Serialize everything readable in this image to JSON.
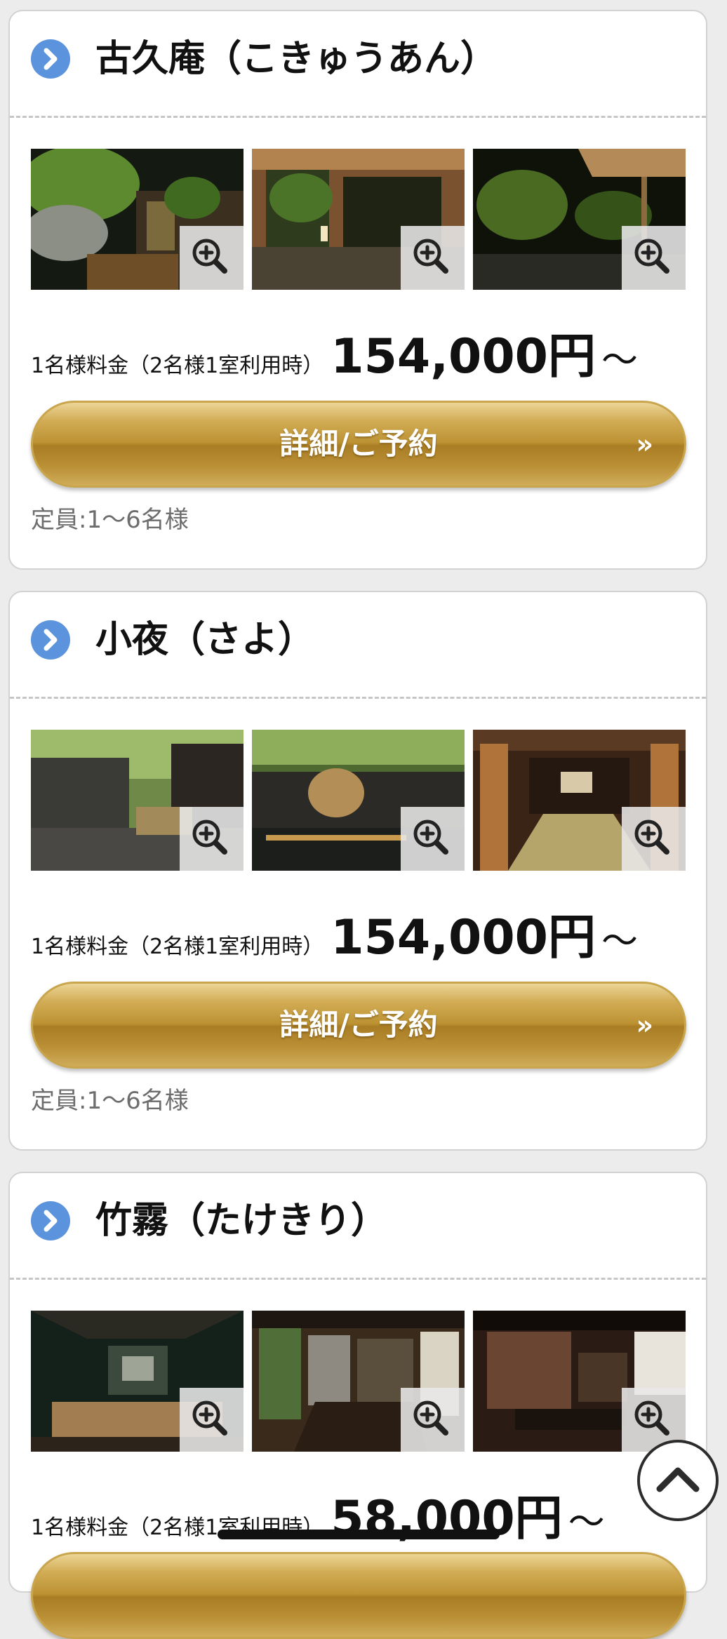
{
  "rooms": [
    {
      "title": "古久庵（こきゅうあん）",
      "price_label": "1名様料金（2名様1室利用時）",
      "price": "154,000円",
      "price_suffix": "〜",
      "button_label": "詳細/ご予約",
      "button_arrow": "»",
      "capacity": "定員:1〜6名様",
      "photos": [
        "garden-night-photo",
        "indoor-bath-photo",
        "terrace-night-photo"
      ]
    },
    {
      "title": "小夜（さよ）",
      "price_label": "1名様料金（2名様1室利用時）",
      "price": "154,000円",
      "price_suffix": "〜",
      "button_label": "詳細/ご予約",
      "button_arrow": "»",
      "capacity": "定員:1〜6名様",
      "photos": [
        "bamboo-deck-photo",
        "bamboo-bath-photo",
        "tatami-corridor-photo"
      ]
    },
    {
      "title": "竹霧（たけきり）",
      "price_label": "1名様料金（2名様1室利用時）",
      "price": "58,000円",
      "price_suffix": "〜",
      "photos": [
        "dark-bath-photo",
        "dining-room-photo",
        "living-room-photo"
      ]
    }
  ],
  "colors": {
    "page_bg": "#ececec",
    "card_bg": "#ffffff",
    "accent_blue": "#5b93dc",
    "gold": "#bc9233",
    "capacity_text": "#6d6d6d"
  },
  "icons": {
    "title_bullet": "chevron-right-icon",
    "photo_overlay": "zoom-in-icon",
    "scroll_top": "chevron-up-icon"
  }
}
